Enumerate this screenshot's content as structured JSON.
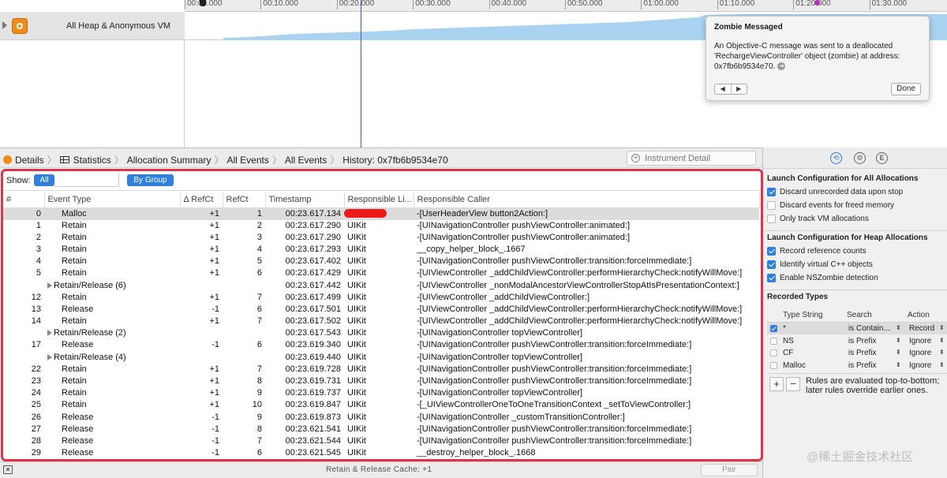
{
  "timeline": {
    "ruler_ticks": [
      "00:00.000",
      "00:10.000",
      "00:20.000",
      "00:30.000",
      "00:40.000",
      "00:50.000",
      "01:00.000",
      "01:10.000",
      "01:20.000",
      "01:30.000"
    ],
    "track_name": "All Heap & Anonymous VM",
    "track_color": "#a9d3f0"
  },
  "popover": {
    "title": "Zombie Messaged",
    "message": "An Objective-C message was sent to a deallocated 'RechargeViewController' object (zombie) at address: 0x7fb6b9534e70.",
    "prev": "◀",
    "next": "▶",
    "done": "Done"
  },
  "breadcrumb": {
    "items": [
      "Details",
      "Statistics",
      "Allocation Summary",
      "All Events",
      "All Events",
      "History: 0x7fb6b9534e70"
    ],
    "instrument_detail_placeholder": "Instrument Detail"
  },
  "show": {
    "label": "Show:",
    "all": "All",
    "by_group": "By Group"
  },
  "table": {
    "columns": [
      "#",
      "Event Type",
      "Δ RefCt",
      "RefCt",
      "Timestamp",
      "Responsible Li...",
      "Responsible Caller"
    ],
    "rows": [
      {
        "num": "0",
        "type": "Malloc",
        "dref": "+1",
        "ref": "1",
        "ts": "00:23.617.134",
        "lib": "",
        "caller": "-[UserHeaderView button2Action:]",
        "sel": true,
        "redacted": true
      },
      {
        "num": "1",
        "type": "Retain",
        "dref": "+1",
        "ref": "2",
        "ts": "00:23.617.290",
        "lib": "UIKit",
        "caller": "-[UINavigationController pushViewController:animated:]"
      },
      {
        "num": "2",
        "type": "Retain",
        "dref": "+1",
        "ref": "3",
        "ts": "00:23.617.290",
        "lib": "UIKit",
        "caller": "-[UINavigationController pushViewController:animated:]"
      },
      {
        "num": "3",
        "type": "Retain",
        "dref": "+1",
        "ref": "4",
        "ts": "00:23.617.293",
        "lib": "UIKit",
        "caller": "__copy_helper_block_.1667"
      },
      {
        "num": "4",
        "type": "Retain",
        "dref": "+1",
        "ref": "5",
        "ts": "00:23.617.402",
        "lib": "UIKit",
        "caller": "-[UINavigationController pushViewController:transition:forceImmediate:]"
      },
      {
        "num": "5",
        "type": "Retain",
        "dref": "+1",
        "ref": "6",
        "ts": "00:23.617.429",
        "lib": "UIKit",
        "caller": "-[UIViewController _addChildViewController:performHierarchyCheck:notifyWillMove:]"
      },
      {
        "num": "",
        "type": "Retain/Release (6)",
        "dref": "",
        "ref": "",
        "ts": "00:23.617.442",
        "lib": "UIKit",
        "caller": "-[UIViewController _nonModalAncestorViewControllerStopAtIsPresentationContext:]",
        "group": true
      },
      {
        "num": "12",
        "type": "Retain",
        "dref": "+1",
        "ref": "7",
        "ts": "00:23.617.499",
        "lib": "UIKit",
        "caller": "-[UIViewController _addChildViewController:]"
      },
      {
        "num": "13",
        "type": "Release",
        "dref": "-1",
        "ref": "6",
        "ts": "00:23.617.501",
        "lib": "UIKit",
        "caller": "-[UIViewController _addChildViewController:performHierarchyCheck:notifyWillMove:]"
      },
      {
        "num": "14",
        "type": "Retain",
        "dref": "+1",
        "ref": "7",
        "ts": "00:23.617.502",
        "lib": "UIKit",
        "caller": "-[UIViewController _addChildViewController:performHierarchyCheck:notifyWillMove:]"
      },
      {
        "num": "",
        "type": "Retain/Release (2)",
        "dref": "",
        "ref": "",
        "ts": "00:23.617.543",
        "lib": "UIKit",
        "caller": "-[UINavigationController topViewController]",
        "group": true
      },
      {
        "num": "17",
        "type": "Release",
        "dref": "-1",
        "ref": "6",
        "ts": "00:23.619.340",
        "lib": "UIKit",
        "caller": "-[UINavigationController pushViewController:transition:forceImmediate:]"
      },
      {
        "num": "",
        "type": "Retain/Release (4)",
        "dref": "",
        "ref": "",
        "ts": "00:23.619.440",
        "lib": "UIKit",
        "caller": "-[UINavigationController topViewController]",
        "group": true
      },
      {
        "num": "22",
        "type": "Retain",
        "dref": "+1",
        "ref": "7",
        "ts": "00:23.619.728",
        "lib": "UIKit",
        "caller": "-[UINavigationController pushViewController:transition:forceImmediate:]"
      },
      {
        "num": "23",
        "type": "Retain",
        "dref": "+1",
        "ref": "8",
        "ts": "00:23.619.731",
        "lib": "UIKit",
        "caller": "-[UINavigationController pushViewController:transition:forceImmediate:]"
      },
      {
        "num": "24",
        "type": "Retain",
        "dref": "+1",
        "ref": "9",
        "ts": "00:23.619.737",
        "lib": "UIKit",
        "caller": "-[UINavigationController topViewController]"
      },
      {
        "num": "25",
        "type": "Retain",
        "dref": "+1",
        "ref": "10",
        "ts": "00:23.619.847",
        "lib": "UIKit",
        "caller": "-[_UIViewControllerOneToOneTransitionContext _setToViewController:]"
      },
      {
        "num": "26",
        "type": "Release",
        "dref": "-1",
        "ref": "9",
        "ts": "00:23.619.873",
        "lib": "UIKit",
        "caller": "-[UINavigationController _customTransitionController:]"
      },
      {
        "num": "27",
        "type": "Release",
        "dref": "-1",
        "ref": "8",
        "ts": "00:23.621.541",
        "lib": "UIKit",
        "caller": "-[UINavigationController pushViewController:transition:forceImmediate:]"
      },
      {
        "num": "28",
        "type": "Release",
        "dref": "-1",
        "ref": "7",
        "ts": "00:23.621.544",
        "lib": "UIKit",
        "caller": "-[UINavigationController pushViewController:transition:forceImmediate:]"
      },
      {
        "num": "29",
        "type": "Release",
        "dref": "-1",
        "ref": "6",
        "ts": "00:23.621.545",
        "lib": "UIKit",
        "caller": "__destroy_helper_block_.1668"
      }
    ]
  },
  "statusbar": {
    "text": "Retain & Release Cache: +1",
    "button": "Pair"
  },
  "inspector": {
    "tabs": [
      "⟲",
      "⚙",
      "E"
    ],
    "all_alloc_title": "Launch Configuration for All Allocations",
    "all_alloc_opts": [
      {
        "label": "Discard unrecorded data upon stop",
        "on": true
      },
      {
        "label": "Discard events for freed memory",
        "on": false
      },
      {
        "label": "Only track VM allocations",
        "on": false
      }
    ],
    "heap_title": "Launch Configuration for Heap Allocations",
    "heap_opts": [
      {
        "label": "Record reference counts",
        "on": true
      },
      {
        "label": "Identify virtual C++ objects",
        "on": true
      },
      {
        "label": "Enable NSZombie detection",
        "on": true
      }
    ],
    "recorded_title": "Recorded Types",
    "recorded_cols": [
      "Type String",
      "Search",
      "Action"
    ],
    "recorded_rows": [
      {
        "type": "*",
        "search": "is Contain...",
        "action": "Record",
        "on": true,
        "sel": true
      },
      {
        "type": "NS",
        "search": "is Prefix",
        "action": "Ignore",
        "on": false
      },
      {
        "type": "CF",
        "search": "is Prefix",
        "action": "Ignore",
        "on": false
      },
      {
        "type": "Malloc",
        "search": "is Prefix",
        "action": "Ignore",
        "on": false
      }
    ],
    "plus": "+",
    "minus": "−",
    "rules_line1": "Rules are evaluated top-to-bottom;",
    "rules_line2": "later rules override earlier ones."
  },
  "watermark": "@稀土掘金技术社区"
}
